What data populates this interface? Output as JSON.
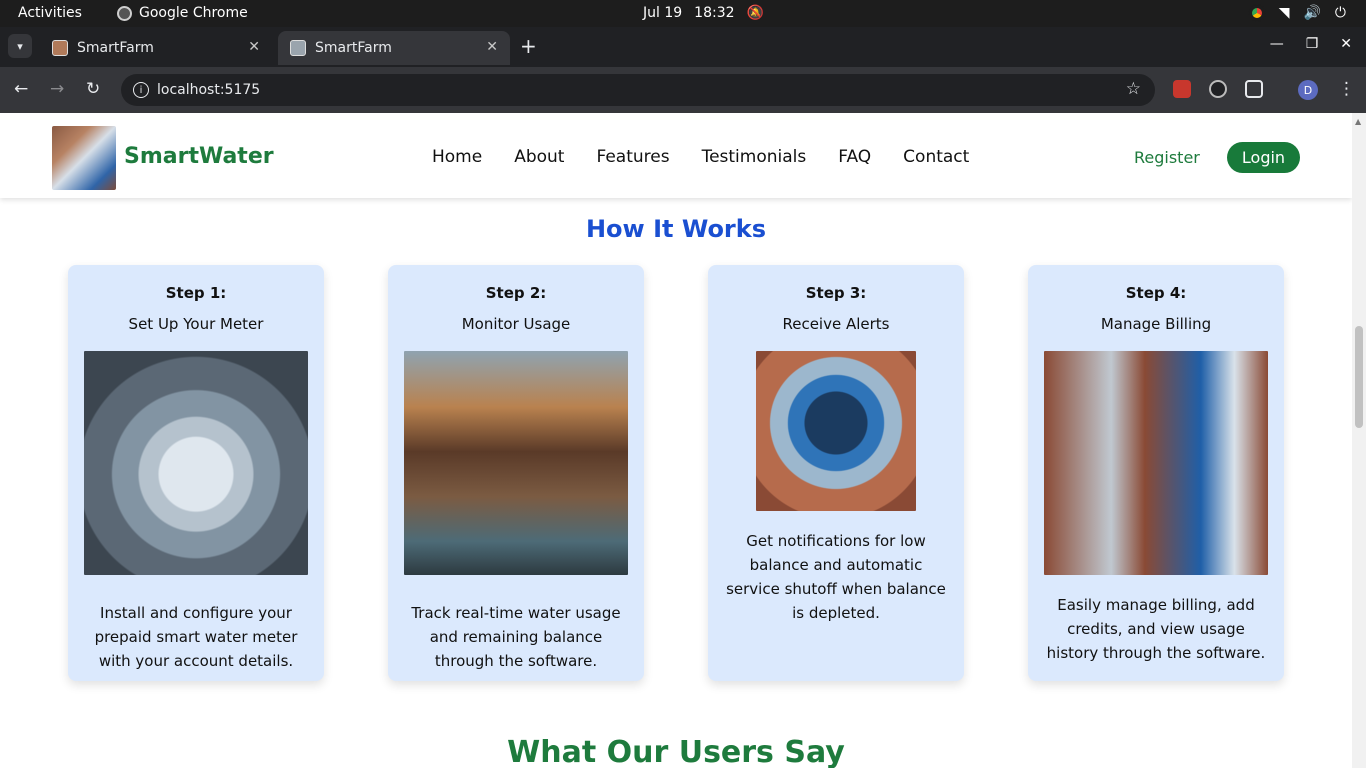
{
  "os": {
    "activities": "Activities",
    "app_name": "Google Chrome",
    "date": "Jul 19",
    "time": "18:32"
  },
  "browser": {
    "tabs": [
      {
        "title": "SmartFarm"
      },
      {
        "title": "SmartFarm"
      }
    ],
    "url": "localhost:5175",
    "profile_initial": "D"
  },
  "site": {
    "brand": "SmartWater",
    "nav": [
      "Home",
      "About",
      "Features",
      "Testimonials",
      "FAQ",
      "Contact"
    ],
    "register": "Register",
    "login": "Login",
    "how_it_works_title": "How It Works",
    "steps": [
      {
        "label": "Step 1:",
        "name": "Set Up Your Meter",
        "desc": "Install and configure your prepaid smart water meter with your account details."
      },
      {
        "label": "Step 2:",
        "name": "Monitor Usage",
        "desc": "Track real-time water usage and remaining balance through the software."
      },
      {
        "label": "Step 3:",
        "name": "Receive Alerts",
        "desc": "Get notifications for low balance and automatic service shutoff when balance is depleted."
      },
      {
        "label": "Step 4:",
        "name": "Manage Billing",
        "desc": "Easily manage billing, add credits, and view usage history through the software."
      }
    ],
    "users_title": "What Our Users Say"
  }
}
